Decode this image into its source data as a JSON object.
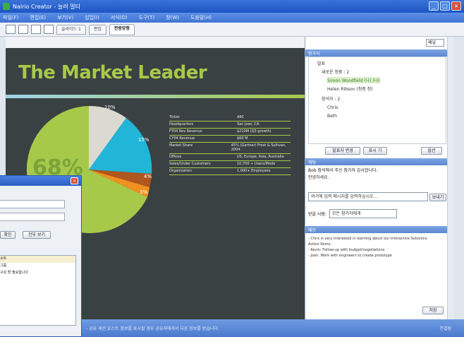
{
  "window": {
    "title": "Nalrio Creator - 늘려 멀티"
  },
  "menu": [
    "파일(F)",
    "편집(E)",
    "보기(V)",
    "삽입(I)",
    "서식(O)",
    "도구(T)",
    "창(W)",
    "도움말(H)"
  ],
  "tabs": [
    "슬라이드 1",
    "편집",
    "판중앙형"
  ],
  "slide": {
    "title": "The Market Leader",
    "big_percent": "68%",
    "pie_labels": [
      "10%",
      "15%",
      "4%",
      "3%"
    ],
    "table": [
      [
        "Ticker",
        "ABC"
      ],
      [
        "Headquarters",
        "San Jose, CA"
      ],
      [
        "FY04 Rev Revenue",
        "$210M (Q3 growth)"
      ],
      [
        "CY04 Revenue",
        "$60 M"
      ],
      [
        "Market Share",
        "45% (Gartner) Frost & Sullivan, 2004"
      ],
      [
        "Offices",
        "US, Europe, Asia, Australia"
      ],
      [
        "Sales/Under Customers",
        "10,700 + Users/Mode"
      ],
      [
        "Organization",
        "1,000+ Employees"
      ]
    ],
    "colors": {
      "bg": "#3a4143",
      "accent": "#a7c94a"
    }
  },
  "right_panel": {
    "dropdown": "패널",
    "participants_header": "참가자",
    "participants": [
      {
        "name": "발표",
        "indent": 0
      },
      {
        "name": "새로운 청중 : 2",
        "indent": 1
      },
      {
        "name": "Simon Woodfield (나) (나)",
        "indent": 2
      },
      {
        "name": "Helen Ribson (청중 청)",
        "indent": 2
      },
      {
        "name": "참석자 : 2",
        "indent": 1
      },
      {
        "name": "Chris",
        "indent": 2
      },
      {
        "name": "Beth",
        "indent": 2
      }
    ],
    "part_buttons": [
      "발표자 변경",
      "표시 기"
    ],
    "part_dropdown": "옵션",
    "chat_header": "채팅",
    "chat_lines": [
      "Bob 참석해서 주신 참가자 감사합니다.",
      "안녕하세요."
    ],
    "chat_placeholder": "여기에 입력 메시지를 입력하십시오...",
    "send_label": "보내기",
    "to_label": "받을 사람:",
    "to_value": "모든 참가자에게",
    "notes_header": "메모",
    "notes": [
      "- Chris is very interested in learning about our Interactive Solutions.",
      "",
      "Action Items:",
      "- Kevin: Follow-up with budget/negotiations",
      "- Joan: Work with engineers to create prototype"
    ],
    "save_label": "저장"
  },
  "status": {
    "text": "- 공유 세션 호스트 정보를 표시할 경우 공유자에게서 다른 정보를 받습니다.",
    "right": "연결됨"
  },
  "dialog": {
    "btn1": "확인",
    "btn2": "전부 보기",
    "list": [
      "",
      "",
      "소트",
      "그룹",
      "구성 할 필요합니다"
    ]
  }
}
